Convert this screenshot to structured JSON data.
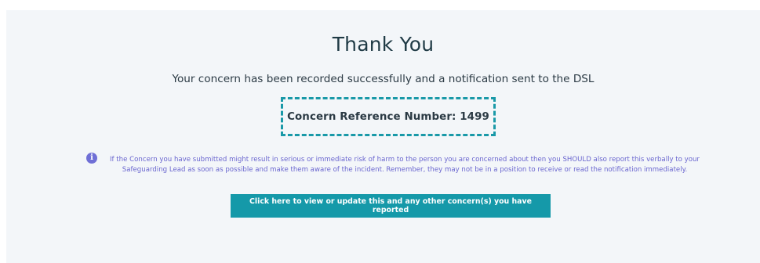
{
  "confirmation": {
    "title": "Thank You",
    "message": "Your concern has been recorded successfully and a notification sent to the DSL",
    "reference": "Concern Reference Number: 1499",
    "warning": "If the Concern you have submitted might result in serious or immediate risk of harm to the person you are concerned about then you SHOULD also report this verbally to your Safeguarding Lead as soon as possible and make them aware of the incident. Remember, they may not be in a position to receive or read the notification immediately.",
    "info_icon_glyph": "i",
    "action_button": "Click here to view or update this and any other concern(s) you have reported"
  },
  "colors": {
    "panel_background": "#f3f6f9",
    "accent": "#1599a9",
    "warning_text": "#6a66cf",
    "heading_text": "#1f3a45"
  },
  "icons": {
    "info": "info-circle-icon"
  }
}
